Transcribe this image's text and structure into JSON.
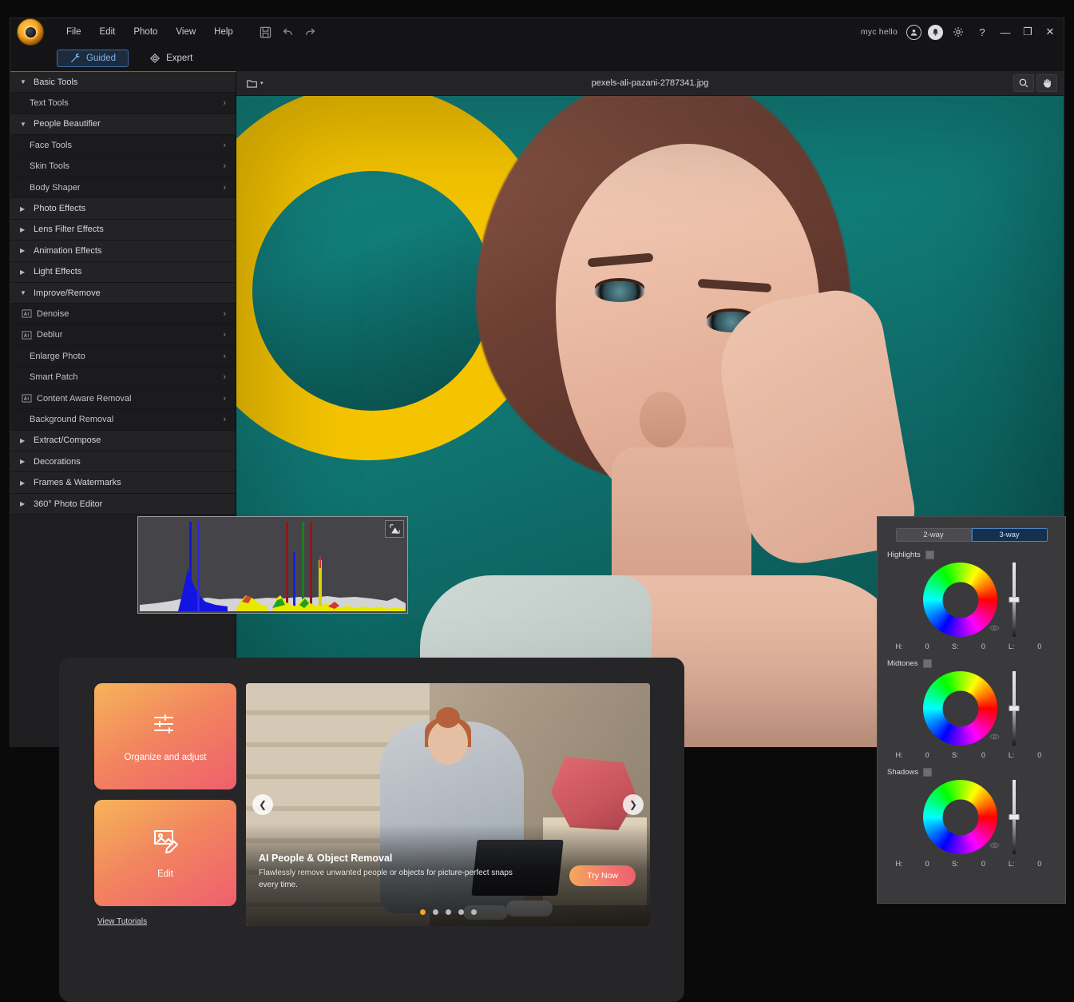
{
  "app": {
    "logo_icon": "tiger-eye-logo",
    "account_label": "myc hello",
    "menu": [
      {
        "label": "File"
      },
      {
        "label": "Edit"
      },
      {
        "label": "Photo"
      },
      {
        "label": "View"
      },
      {
        "label": "Help"
      }
    ],
    "toolbar_icons": [
      {
        "name": "save-icon"
      },
      {
        "name": "undo-icon"
      },
      {
        "name": "redo-icon"
      }
    ],
    "titlebar_right": [
      {
        "name": "account-icon"
      },
      {
        "name": "notification-icon"
      },
      {
        "name": "settings-gear-icon"
      },
      {
        "name": "help-icon"
      }
    ],
    "window_controls": {
      "minimize": "—",
      "maximize": "❐",
      "close": "✕"
    }
  },
  "modes": [
    {
      "label": "Guided",
      "icon": "magic-wand-icon",
      "active": true
    },
    {
      "label": "Expert",
      "icon": "diamond-layers-icon",
      "active": false
    }
  ],
  "sidebar": {
    "items": [
      {
        "label": "Basic Tools",
        "type": "group",
        "expanded": true,
        "icon": null
      },
      {
        "label": "Text Tools",
        "type": "sub",
        "chevron": "›",
        "icon": null
      },
      {
        "label": "People Beautifier",
        "type": "group",
        "expanded": true,
        "icon": null
      },
      {
        "label": "Face Tools",
        "type": "sub",
        "chevron": "›",
        "icon": null
      },
      {
        "label": "Skin Tools",
        "type": "sub",
        "chevron": "›",
        "icon": null
      },
      {
        "label": "Body Shaper",
        "type": "sub",
        "chevron": "›",
        "icon": null
      },
      {
        "label": "Photo Effects",
        "type": "group",
        "expanded": false,
        "icon": null
      },
      {
        "label": "Lens Filter Effects",
        "type": "group",
        "expanded": false,
        "icon": null
      },
      {
        "label": "Animation Effects",
        "type": "group",
        "expanded": false,
        "icon": null
      },
      {
        "label": "Light Effects",
        "type": "group",
        "expanded": false,
        "icon": null
      },
      {
        "label": "Improve/Remove",
        "type": "group",
        "expanded": true,
        "icon": null
      },
      {
        "label": "Denoise",
        "type": "sub",
        "chevron": "›",
        "icon": "ai-badge-icon"
      },
      {
        "label": "Deblur",
        "type": "sub",
        "chevron": "›",
        "icon": "ai-badge-icon"
      },
      {
        "label": "Enlarge Photo",
        "type": "sub",
        "chevron": "›",
        "icon": null
      },
      {
        "label": "Smart Patch",
        "type": "sub",
        "chevron": "›",
        "icon": null
      },
      {
        "label": "Content Aware Removal",
        "type": "sub",
        "chevron": "›",
        "icon": "ai-badge-icon"
      },
      {
        "label": "Background Removal",
        "type": "sub",
        "chevron": "›",
        "icon": null
      },
      {
        "label": "Extract/Compose",
        "type": "group",
        "expanded": false,
        "icon": null
      },
      {
        "label": "Decorations",
        "type": "group",
        "expanded": false,
        "icon": null
      },
      {
        "label": "Frames & Watermarks",
        "type": "group",
        "expanded": false,
        "icon": null
      },
      {
        "label": "360° Photo Editor",
        "type": "group",
        "expanded": false,
        "icon": null
      }
    ],
    "expanded_glyph": "▼",
    "collapsed_glyph": "▶"
  },
  "canvas": {
    "open_icon": "open-file-icon",
    "open_caret": "▾",
    "filename": "pexels-ali-pazani-2787341.jpg",
    "tools": [
      {
        "name": "zoom-tool-icon"
      },
      {
        "name": "hand-tool-icon"
      }
    ]
  },
  "histogram": {
    "warning_icon": "clipping-warning-icon"
  },
  "color_panel": {
    "tabs": [
      {
        "label": "2-way",
        "active": false
      },
      {
        "label": "3-way",
        "active": true
      }
    ],
    "groups": [
      {
        "label": "Highlights",
        "swatch_color": "#6d6d73",
        "eyedropper_icon": "eyedropper-icon",
        "slider_value": 50,
        "fields": [
          {
            "key": "H:",
            "value": "0"
          },
          {
            "key": "S:",
            "value": "0"
          },
          {
            "key": "L:",
            "value": "0"
          }
        ]
      },
      {
        "label": "Midtones",
        "swatch_color": "#6d6d73",
        "eyedropper_icon": "eyedropper-icon",
        "slider_value": 50,
        "fields": [
          {
            "key": "H:",
            "value": "0"
          },
          {
            "key": "S:",
            "value": "0"
          },
          {
            "key": "L:",
            "value": "0"
          }
        ]
      },
      {
        "label": "Shadows",
        "swatch_color": "#6d6d73",
        "eyedropper_icon": "eyedropper-icon",
        "slider_value": 50,
        "fields": [
          {
            "key": "H:",
            "value": "0"
          },
          {
            "key": "S:",
            "value": "0"
          },
          {
            "key": "L:",
            "value": "0"
          }
        ]
      }
    ]
  },
  "launcher": {
    "tiles": [
      {
        "label": "Organize and adjust",
        "icon": "sliders-icon"
      },
      {
        "label": "Edit",
        "icon": "photo-edit-pencil-icon"
      }
    ],
    "tutorials_link": "View Tutorials",
    "carousel": {
      "title": "AI People & Object Removal",
      "description": "Flawlessly remove unwanted people or objects for picture-perfect snaps every time.",
      "cta_label": "Try Now",
      "prev_icon": "chevron-left-icon",
      "next_icon": "chevron-right-icon",
      "dot_count": 5,
      "active_dot": 0,
      "active_dot_color": "#f5a623"
    }
  },
  "theme": {
    "accent_blue": "#3a6ea5",
    "accent_orange": "#f5a623",
    "panel_bg": "#1e1e20",
    "window_bg": "#1b1b1d"
  }
}
